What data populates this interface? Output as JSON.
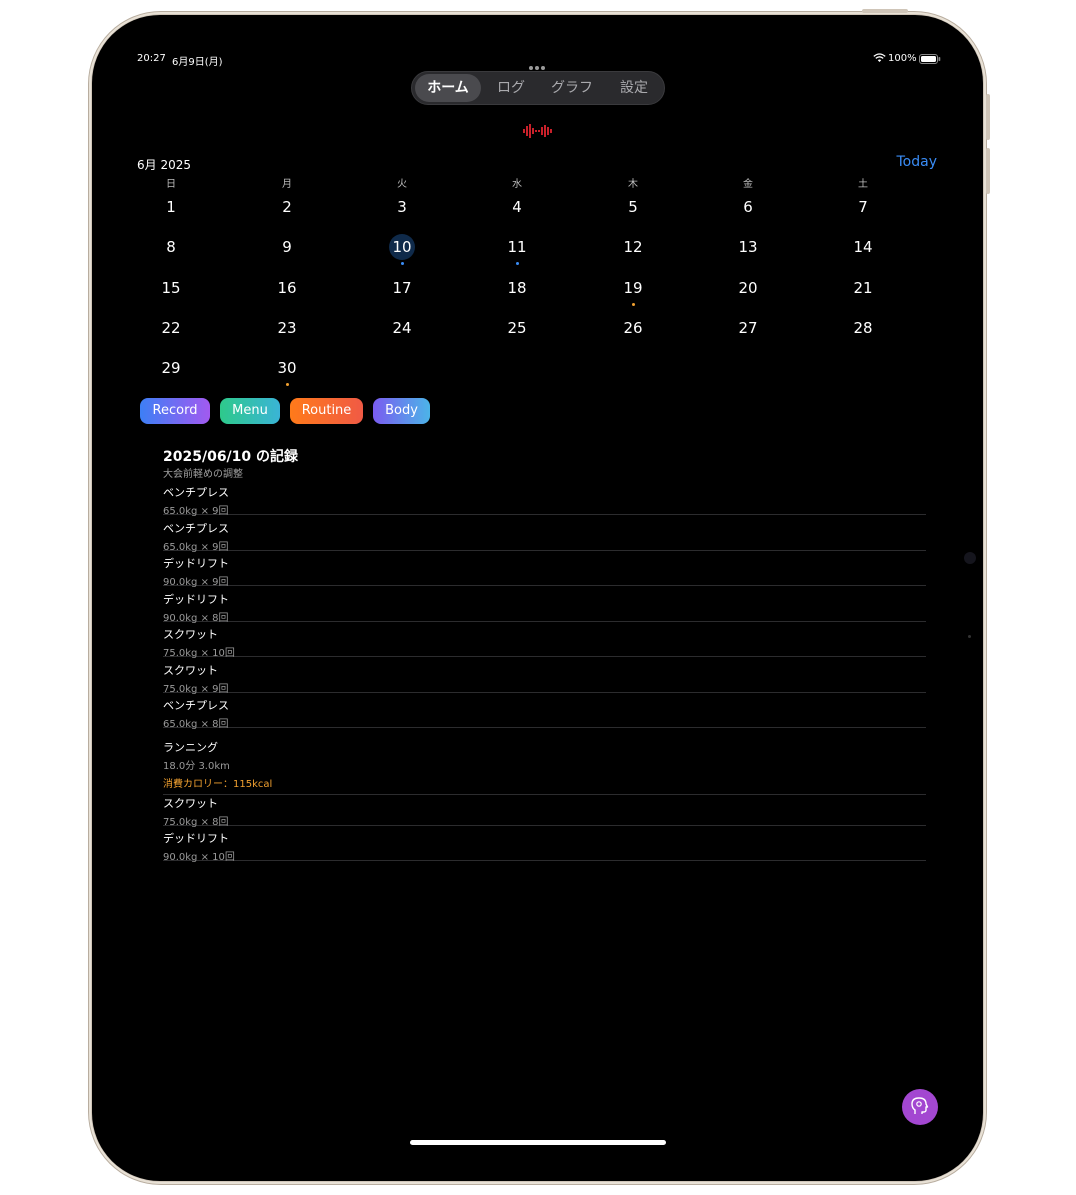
{
  "status": {
    "time": "20:27",
    "date": "6月9日(月)",
    "battery": "100%"
  },
  "tabs": [
    {
      "label": "ホーム",
      "active": true
    },
    {
      "label": "ログ",
      "active": false
    },
    {
      "label": "グラフ",
      "active": false
    },
    {
      "label": "設定",
      "active": false
    }
  ],
  "calendar": {
    "month_label": "6月 2025",
    "today_label": "Today",
    "weekdays": [
      "日",
      "月",
      "火",
      "水",
      "木",
      "金",
      "土"
    ],
    "selected_day": "10",
    "weeks": [
      [
        "1",
        "2",
        "3",
        "4",
        "5",
        "6",
        "7"
      ],
      [
        "8",
        "9",
        "10",
        "11",
        "12",
        "13",
        "14"
      ],
      [
        "15",
        "16",
        "17",
        "18",
        "19",
        "20",
        "21"
      ],
      [
        "22",
        "23",
        "24",
        "25",
        "26",
        "27",
        "28"
      ],
      [
        "29",
        "30",
        "",
        "",
        "",
        "",
        ""
      ]
    ],
    "marks": [
      {
        "day": "10",
        "color": "#3a8cf5"
      },
      {
        "day": "11",
        "color": "#3a8cf5"
      },
      {
        "day": "19",
        "color": "#f0a030"
      },
      {
        "day": "30",
        "color": "#f0a030"
      }
    ]
  },
  "actions": [
    {
      "label": "Record"
    },
    {
      "label": "Menu"
    },
    {
      "label": "Routine"
    },
    {
      "label": "Body"
    }
  ],
  "record": {
    "title": "2025/06/10 の記録",
    "subtitle": "大会前軽めの調整",
    "entries": [
      {
        "name": "ベンチプレス",
        "detail": "65.0kg × 9回"
      },
      {
        "name": "ベンチプレス",
        "detail": "65.0kg × 9回"
      },
      {
        "name": "デッドリフト",
        "detail": "90.0kg × 9回"
      },
      {
        "name": "デッドリフト",
        "detail": "90.0kg × 8回"
      },
      {
        "name": "スクワット",
        "detail": "75.0kg × 10回"
      },
      {
        "name": "スクワット",
        "detail": "75.0kg × 9回"
      },
      {
        "name": "ベンチプレス",
        "detail": "65.0kg × 8回"
      },
      {
        "name": "ランニング",
        "detail": "18.0分 3.0km",
        "calories": "消費カロリー：115kcal"
      },
      {
        "name": "スクワット",
        "detail": "75.0kg × 8回"
      },
      {
        "name": "デッドリフト",
        "detail": "90.0kg × 10回"
      }
    ]
  },
  "icons": {
    "wifi": "wifi-icon",
    "battery": "battery-icon",
    "waveform": "waveform-icon",
    "assistant": "assistant-head-icon"
  },
  "colors": {
    "accent": "#3a8cf5",
    "calorie": "#f0a030",
    "fab": "#a347d1"
  }
}
